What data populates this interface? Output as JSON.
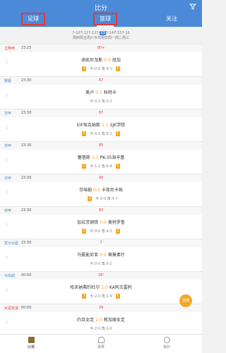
{
  "header": {
    "title": "比分",
    "tabs": [
      {
        "label": "足球"
      },
      {
        "label": "篮球"
      },
      {
        "label": "关注"
      }
    ]
  },
  "date_bar": {
    "line1": "7-107-117-127-",
    "selected": "13",
    "line1_rest": "7-147-157-16",
    "line2": "四六日一二 三",
    "weekdays": "周四周五周六今日周日周一周二周三"
  },
  "matches": [
    {
      "league": "立陶甲",
      "league_color": "#e53935",
      "time": "23:25",
      "status": "90+",
      "home": "迪凯尼戈斯",
      "score": "0:0",
      "away": "班加",
      "odds": "半:0-0 角:4-1",
      "left_badge": "1",
      "right_badge": "1"
    },
    {
      "league": "挪超",
      "league_color": "#4a8ad8",
      "time": "23:30",
      "status": "87",
      "home": "奥卢",
      "score": "0:1",
      "away": "科特卡",
      "odds": "半:0-1 角:0-2",
      "left_badge": "",
      "right_badge": ""
    },
    {
      "league": "芬甲",
      "league_color": "#4a8ad8",
      "time": "23:30",
      "status": "87",
      "home": "EIF埃克纳斯",
      "score": "2:1",
      "away": "SJK学院",
      "odds": "半:0-1 角:6-1",
      "left_badge": "1",
      "right_badge": "1"
    },
    {
      "league": "芬甲",
      "league_color": "#4a8ad8",
      "time": "23:30",
      "status": "85",
      "home": "塞普斯",
      "score": "1:3",
      "away": "PK-35海辛基",
      "odds": "半:1-2 角:6-4",
      "left_badge": "1",
      "right_badge": "1"
    },
    {
      "league": "芬甲",
      "league_color": "#4a8ad8",
      "time": "23:30",
      "status": "90",
      "home": "莎埃勒",
      "score": "0:0",
      "away": "卡亚尼卡帕",
      "odds": "半:0-0 角:4-7",
      "left_badge": "1",
      "right_badge": ""
    },
    {
      "league": "芬甲",
      "league_color": "#2e9e5b",
      "time": "23:30",
      "status": "83",
      "home": "加拉茨钢铁",
      "score": "0:0",
      "away": "奥特罗鲁",
      "odds": "半:0-0 角:4-3",
      "left_badge": "2",
      "right_badge": "2"
    },
    {
      "league": "爱沙女超",
      "league_color": "#4a8ad8",
      "time": "23:30",
      "status": "7",
      "home": "马冕能尼亚",
      "score": "0:0",
      "away": "蒂莫弗什",
      "odds": "半:0-0 角:0-2",
      "left_badge": "",
      "right_badge": ""
    },
    {
      "league": "冰岛超",
      "league_color": "#4a8ad8",
      "time": "00:00",
      "status": "59'",
      "home": "哈夫纳弗约杜尔",
      "score": "2:0",
      "away": "KA阿古雷利",
      "odds": "半:2-0 角:2-4",
      "left_badge": "1",
      "right_badge": "1"
    },
    {
      "league": "女足友谊",
      "league_color": "#e53935",
      "time": "00:00",
      "status": "39",
      "home": "约旦女足",
      "score": "2:0",
      "away": "新加坡女足",
      "odds": "半:2-0 角:0-0",
      "left_badge": "",
      "right_badge": ""
    }
  ],
  "fab": {
    "label": "直播"
  },
  "bottom_nav": [
    {
      "label": "比赛"
    },
    {
      "label": "赛果"
    },
    {
      "label": "我的"
    }
  ]
}
